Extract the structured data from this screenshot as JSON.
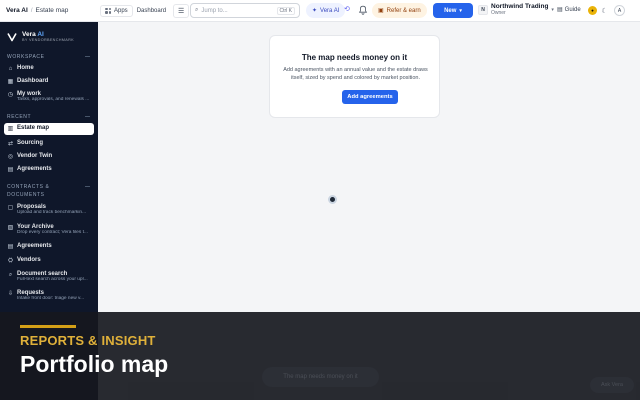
{
  "header": {
    "app_name": "Vera AI",
    "breadcrumb_sep": "/",
    "page_name": "Estate map",
    "apps_label": "Apps",
    "dashboard_label": "Dashboard",
    "search_placeholder": "Jump to...",
    "search_shortcut": "Ctrl K",
    "vera_label": "Vera AI",
    "refer_label": "Refer & earn",
    "new_label": "New",
    "org_initial": "N",
    "org_name": "Northwind Trading",
    "org_role": "Owner",
    "guide_label": "Guide",
    "user_initial": "A"
  },
  "sidebar": {
    "brand_name": "Vera",
    "brand_suffix": "AI",
    "brand_tagline": "BY VENDORBENCHMARK",
    "sections": {
      "workspace": "WORKSPACE",
      "recent": "RECENT",
      "contracts": "CONTRACTS &",
      "contracts2": "DOCUMENTS"
    },
    "items": [
      {
        "label": "Home",
        "sub": "",
        "icon": "home-icon"
      },
      {
        "label": "Dashboard",
        "sub": "",
        "icon": "dashboard-icon"
      },
      {
        "label": "My work",
        "sub": "Tasks, approvals, and renewals ...",
        "icon": "clock-icon"
      },
      {
        "label": "Estate map",
        "sub": "",
        "icon": "map-icon"
      },
      {
        "label": "Sourcing",
        "sub": "",
        "icon": "sourcing-icon"
      },
      {
        "label": "Vendor Twin",
        "sub": "",
        "icon": "twin-icon"
      },
      {
        "label": "Agreements",
        "sub": "",
        "icon": "agreements-icon"
      },
      {
        "label": "Proposals",
        "sub": "Upload and track benchmarkin...",
        "icon": "proposals-icon"
      },
      {
        "label": "Your Archive",
        "sub": "Drop every contract; Vera files t...",
        "icon": "archive-icon"
      },
      {
        "label": "Agreements",
        "sub": "",
        "icon": "agreements-icon"
      },
      {
        "label": "Vendors",
        "sub": "",
        "icon": "vendors-icon"
      },
      {
        "label": "Document search",
        "sub": "Full-text search across your upl...",
        "icon": "doc-search-icon"
      },
      {
        "label": "Requests",
        "sub": "Intake front door: triage new v...",
        "icon": "requests-icon"
      }
    ]
  },
  "main": {
    "empty_title": "The map needs money on it",
    "empty_desc": "Add agreements with an annual value and the estate draws itself, sized by spend and colored by market position.",
    "cta_label": "Add agreements",
    "toast_text": "The map needs money on it",
    "ask_label": "Ask Vera"
  },
  "caption": {
    "kicker": "REPORTS & INSIGHT",
    "headline": "Portfolio map"
  },
  "colors": {
    "accent": "#2563eb",
    "sidebar_bg": "#0f172a",
    "caption_gold": "#e0b13a"
  }
}
